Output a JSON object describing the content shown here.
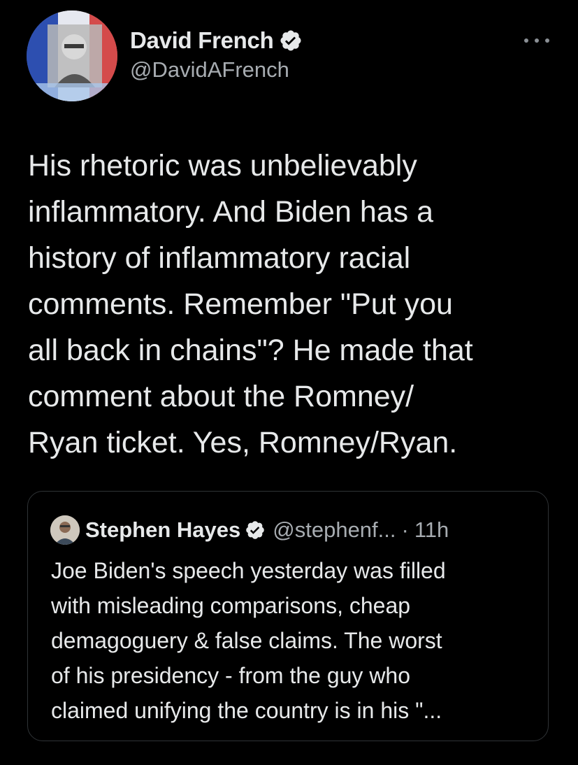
{
  "tweet": {
    "author": {
      "name": "David French",
      "handle": "@DavidAFrench",
      "verified": true,
      "avatar_icon": "profile-photo-with-french-flag"
    },
    "more_icon": "more-options-icon",
    "text": "His rhetoric was unbelievably\ninflammatory. And Biden has a\nhistory of inflammatory racial\ncomments. Remember \"Put you\nall back in chains\"? He made that\ncomment about the Romney/\nRyan ticket. Yes, Romney/Ryan."
  },
  "quote": {
    "author": {
      "name": "Stephen Hayes",
      "handle": "@stephenf...",
      "verified": true,
      "avatar_icon": "profile-photo"
    },
    "separator": "·",
    "time": "11h",
    "text": "Joe Biden's speech yesterday was filled\nwith misleading comparisons, cheap\ndemagoguery & false claims. The worst\nof his presidency - from the guy who\nclaimed unifying the country is in his \"..."
  },
  "colors": {
    "background": "#000000",
    "text_primary": "#e7e9ea",
    "text_secondary": "#a7acb1",
    "verified_badge": "#e7e9ea",
    "border": "#2f3336"
  }
}
